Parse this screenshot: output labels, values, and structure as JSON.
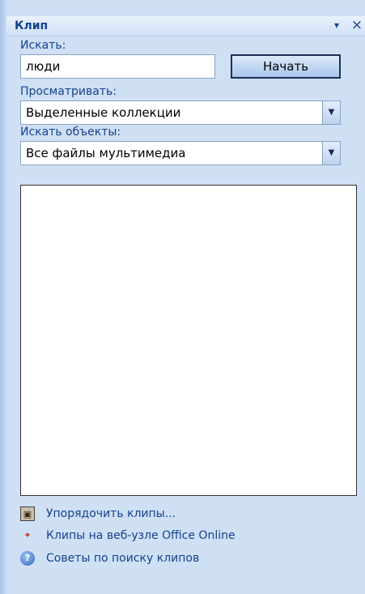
{
  "pane": {
    "title": "Клип",
    "menu_glyph": "▾",
    "close_glyph": "×"
  },
  "search": {
    "label": "Искать:",
    "value": "люди",
    "go_label": "Начать"
  },
  "browse": {
    "label": "Просматривать:",
    "selected": "Выделенные коллекции"
  },
  "types": {
    "label": "Искать объекты:",
    "selected": "Все файлы мультимедиа"
  },
  "links": [
    {
      "label": "Упорядочить клипы...",
      "icon": "organize-clips-icon"
    },
    {
      "label": "Клипы на веб-узле Office Online",
      "icon": "office-online-icon"
    },
    {
      "label": "Советы по поиску клипов",
      "icon": "help-icon"
    }
  ],
  "colors": {
    "pane_bg": "#cfe0f5",
    "label_text": "#15428b"
  }
}
